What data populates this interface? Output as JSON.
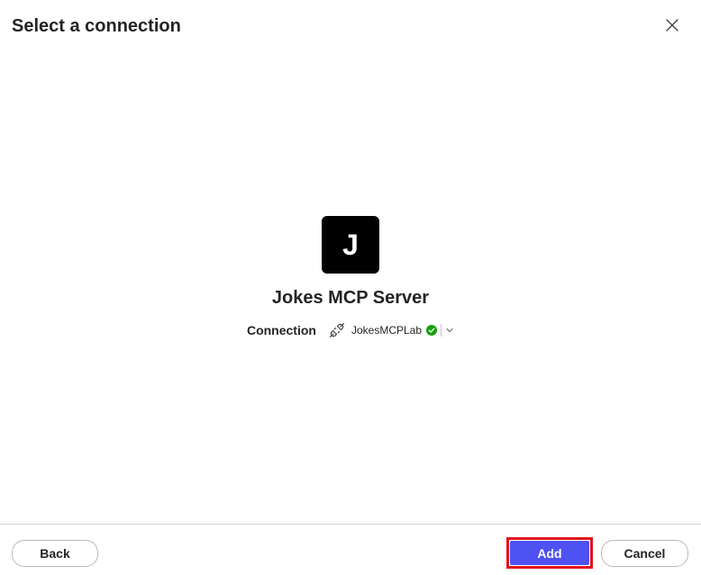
{
  "dialog": {
    "title": "Select a connection"
  },
  "server": {
    "logo_letter": "J",
    "name": "Jokes MCP Server"
  },
  "connection": {
    "label": "Connection",
    "selected": "JokesMCPLab",
    "status_color": "#13a10e"
  },
  "footer": {
    "back_label": "Back",
    "add_label": "Add",
    "cancel_label": "Cancel"
  },
  "colors": {
    "accent": "#4f52f2",
    "highlight": "#e0141e"
  },
  "icons": {
    "close": "close-icon",
    "plug": "plug-connection-icon",
    "status": "checkmark-circle-icon",
    "dropdown": "chevron-down-icon"
  }
}
